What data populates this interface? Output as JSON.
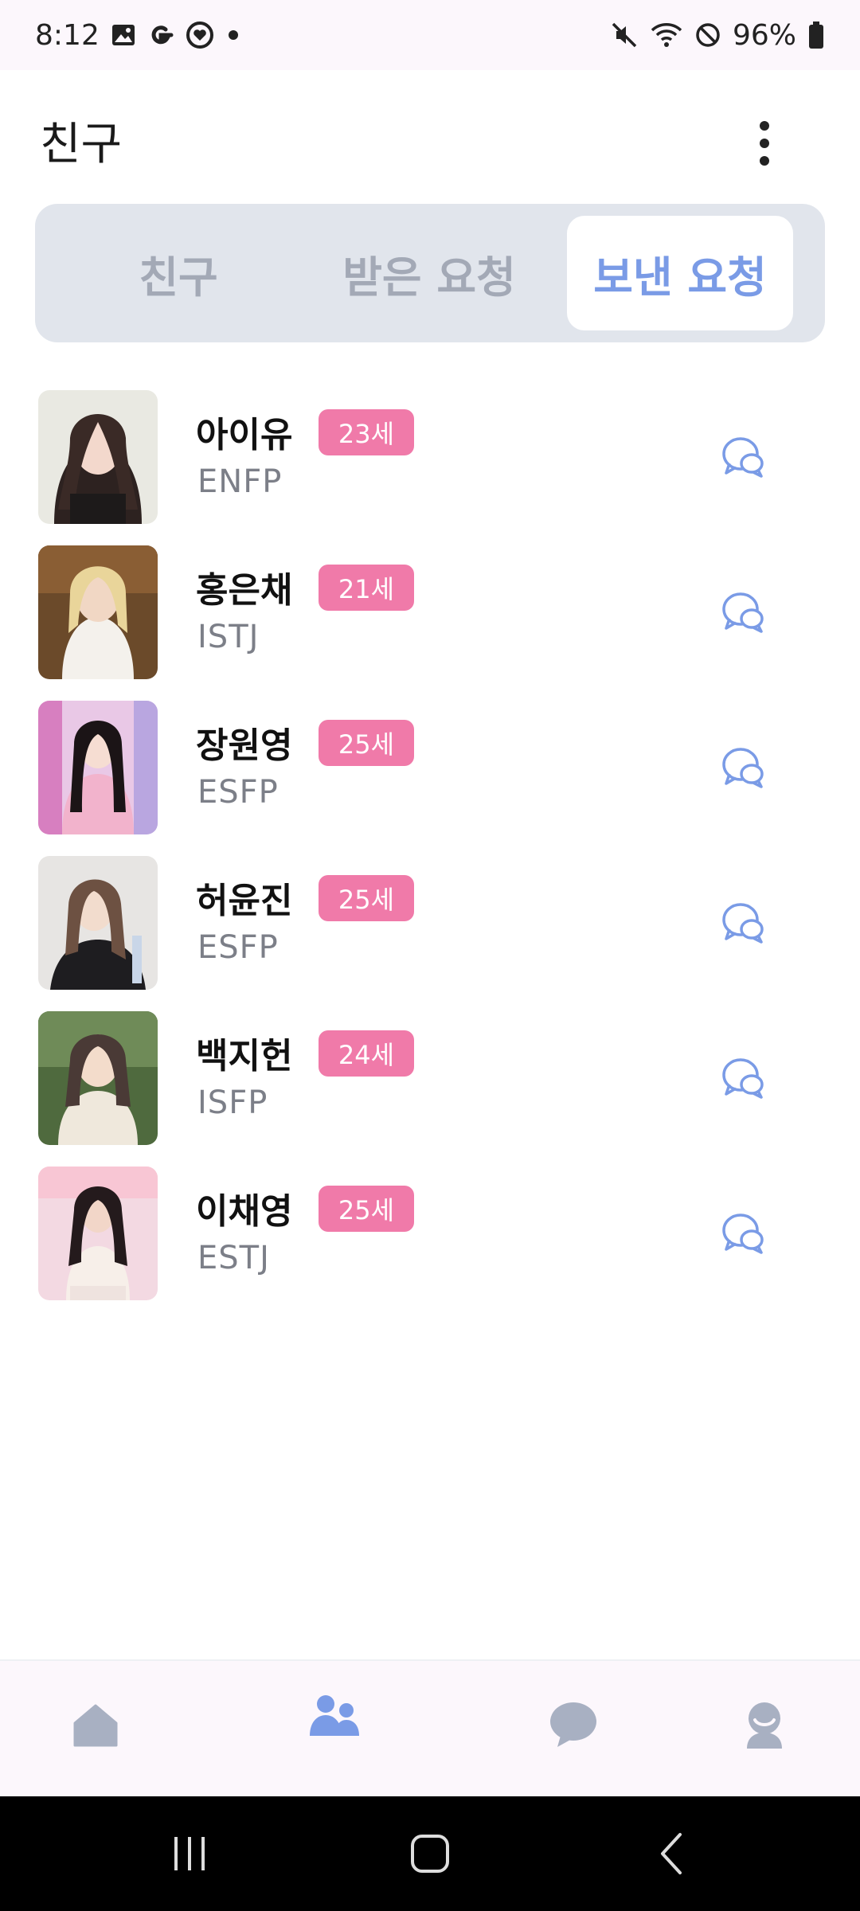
{
  "status_bar": {
    "time": "8:12",
    "battery": "96%",
    "left_icons": [
      "gallery-icon",
      "google-icon",
      "heart-badge-icon",
      "notification-dot-icon"
    ],
    "right_icons": [
      "mute-icon",
      "wifi-icon",
      "do-not-disturb-icon",
      "battery-icon"
    ]
  },
  "header": {
    "title": "친구",
    "menu_icon": "more-vert-icon"
  },
  "tabs": [
    {
      "label": "친구",
      "active": false
    },
    {
      "label": "받은 요청",
      "active": false
    },
    {
      "label": "보낸 요청",
      "active": true
    }
  ],
  "friends": [
    {
      "name": "아이유",
      "age": "23세",
      "mbti": "ENFP"
    },
    {
      "name": "홍은채",
      "age": "21세",
      "mbti": "ISTJ"
    },
    {
      "name": "장원영",
      "age": "25세",
      "mbti": "ESFP"
    },
    {
      "name": "허윤진",
      "age": "25세",
      "mbti": "ESFP"
    },
    {
      "name": "백지헌",
      "age": "24세",
      "mbti": "ISFP"
    },
    {
      "name": "이채영",
      "age": "25세",
      "mbti": "ESTJ"
    }
  ],
  "bottom_nav": [
    {
      "icon": "home-icon",
      "active": false
    },
    {
      "icon": "people-icon",
      "active": true
    },
    {
      "icon": "chat-bubble-icon",
      "active": false
    },
    {
      "icon": "profile-icon",
      "active": false
    }
  ],
  "colors": {
    "accent": "#7a9be6",
    "badge": "#f07aa9",
    "tab_background": "#e1e5ec",
    "inactive_icon": "#a8b0c2"
  }
}
